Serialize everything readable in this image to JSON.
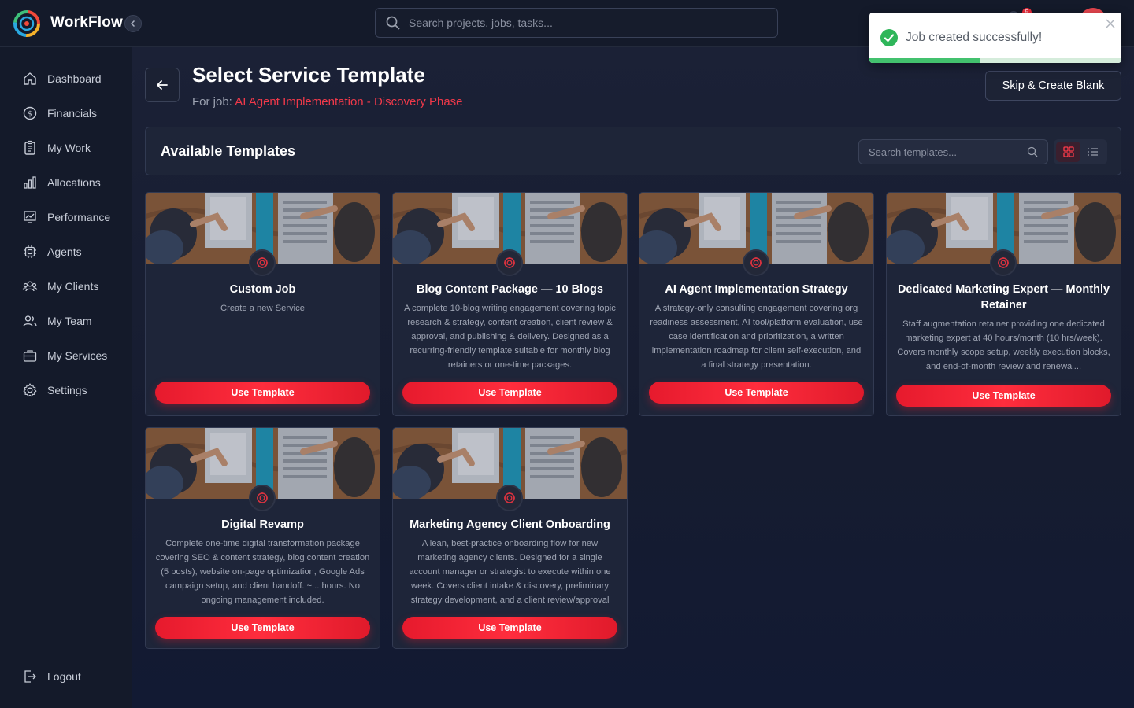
{
  "app": {
    "brand": "WorkFlow",
    "search_placeholder": "Search projects, jobs, tasks...",
    "notification_count": "5"
  },
  "sidebar": {
    "items": [
      {
        "label": "Dashboard",
        "icon": "home-icon"
      },
      {
        "label": "Financials",
        "icon": "dollar-icon"
      },
      {
        "label": "My Work",
        "icon": "clipboard-icon"
      },
      {
        "label": "Allocations",
        "icon": "bar-chart-icon"
      },
      {
        "label": "Performance",
        "icon": "trend-chart-icon"
      },
      {
        "label": "Agents",
        "icon": "cpu-icon"
      },
      {
        "label": "My Clients",
        "icon": "users-icon"
      },
      {
        "label": "My Team",
        "icon": "team-icon"
      },
      {
        "label": "My Services",
        "icon": "briefcase-icon"
      },
      {
        "label": "Settings",
        "icon": "gear-icon"
      }
    ],
    "logout_label": "Logout"
  },
  "header": {
    "title": "Select Service Template",
    "subtitle_prefix": "For job:",
    "job_name": "AI Agent Implementation - Discovery Phase",
    "skip_label": "Skip & Create Blank"
  },
  "templates": {
    "heading": "Available Templates",
    "search_placeholder": "Search templates...",
    "active_view": "grid",
    "button_label": "Use Template",
    "items": [
      {
        "title": "Custom Job",
        "description": "Create a new Service"
      },
      {
        "title": "Blog Content Package — 10 Blogs",
        "description": "A complete 10-blog writing engagement covering topic research & strategy, content creation, client review & approval, and publishing & delivery. Designed as a recurring-friendly template suitable for monthly blog retainers or one-time packages."
      },
      {
        "title": "AI Agent Implementation Strategy",
        "description": "A strategy-only consulting engagement covering org readiness assessment, AI tool/platform evaluation, use case identification and prioritization, a written implementation roadmap for client self-execution, and a final strategy presentation."
      },
      {
        "title": "Dedicated Marketing Expert — Monthly Retainer",
        "description": "Staff augmentation retainer providing one dedicated marketing expert at 40 hours/month (10 hrs/week). Covers monthly scope setup, weekly execution blocks, and end-of-month review and renewal..."
      },
      {
        "title": "Digital Revamp",
        "description": "Complete one-time digital transformation package covering SEO & content strategy, blog content creation (5 posts), website on-page optimization, Google Ads campaign setup, and client handoff. ~... hours. No ongoing management included."
      },
      {
        "title": "Marketing Agency Client Onboarding",
        "description": "A lean, best-practice onboarding flow for new marketing agency clients. Designed for a single account manager or strategist to execute within one week. Covers client intake & discovery, preliminary strategy development, and a client review/approval"
      }
    ]
  },
  "toast": {
    "message": "Job created successfully!",
    "progress": 0.44
  },
  "colors": {
    "accent": "#ff2d3d",
    "link": "#f0394a",
    "success": "#43c16e"
  }
}
